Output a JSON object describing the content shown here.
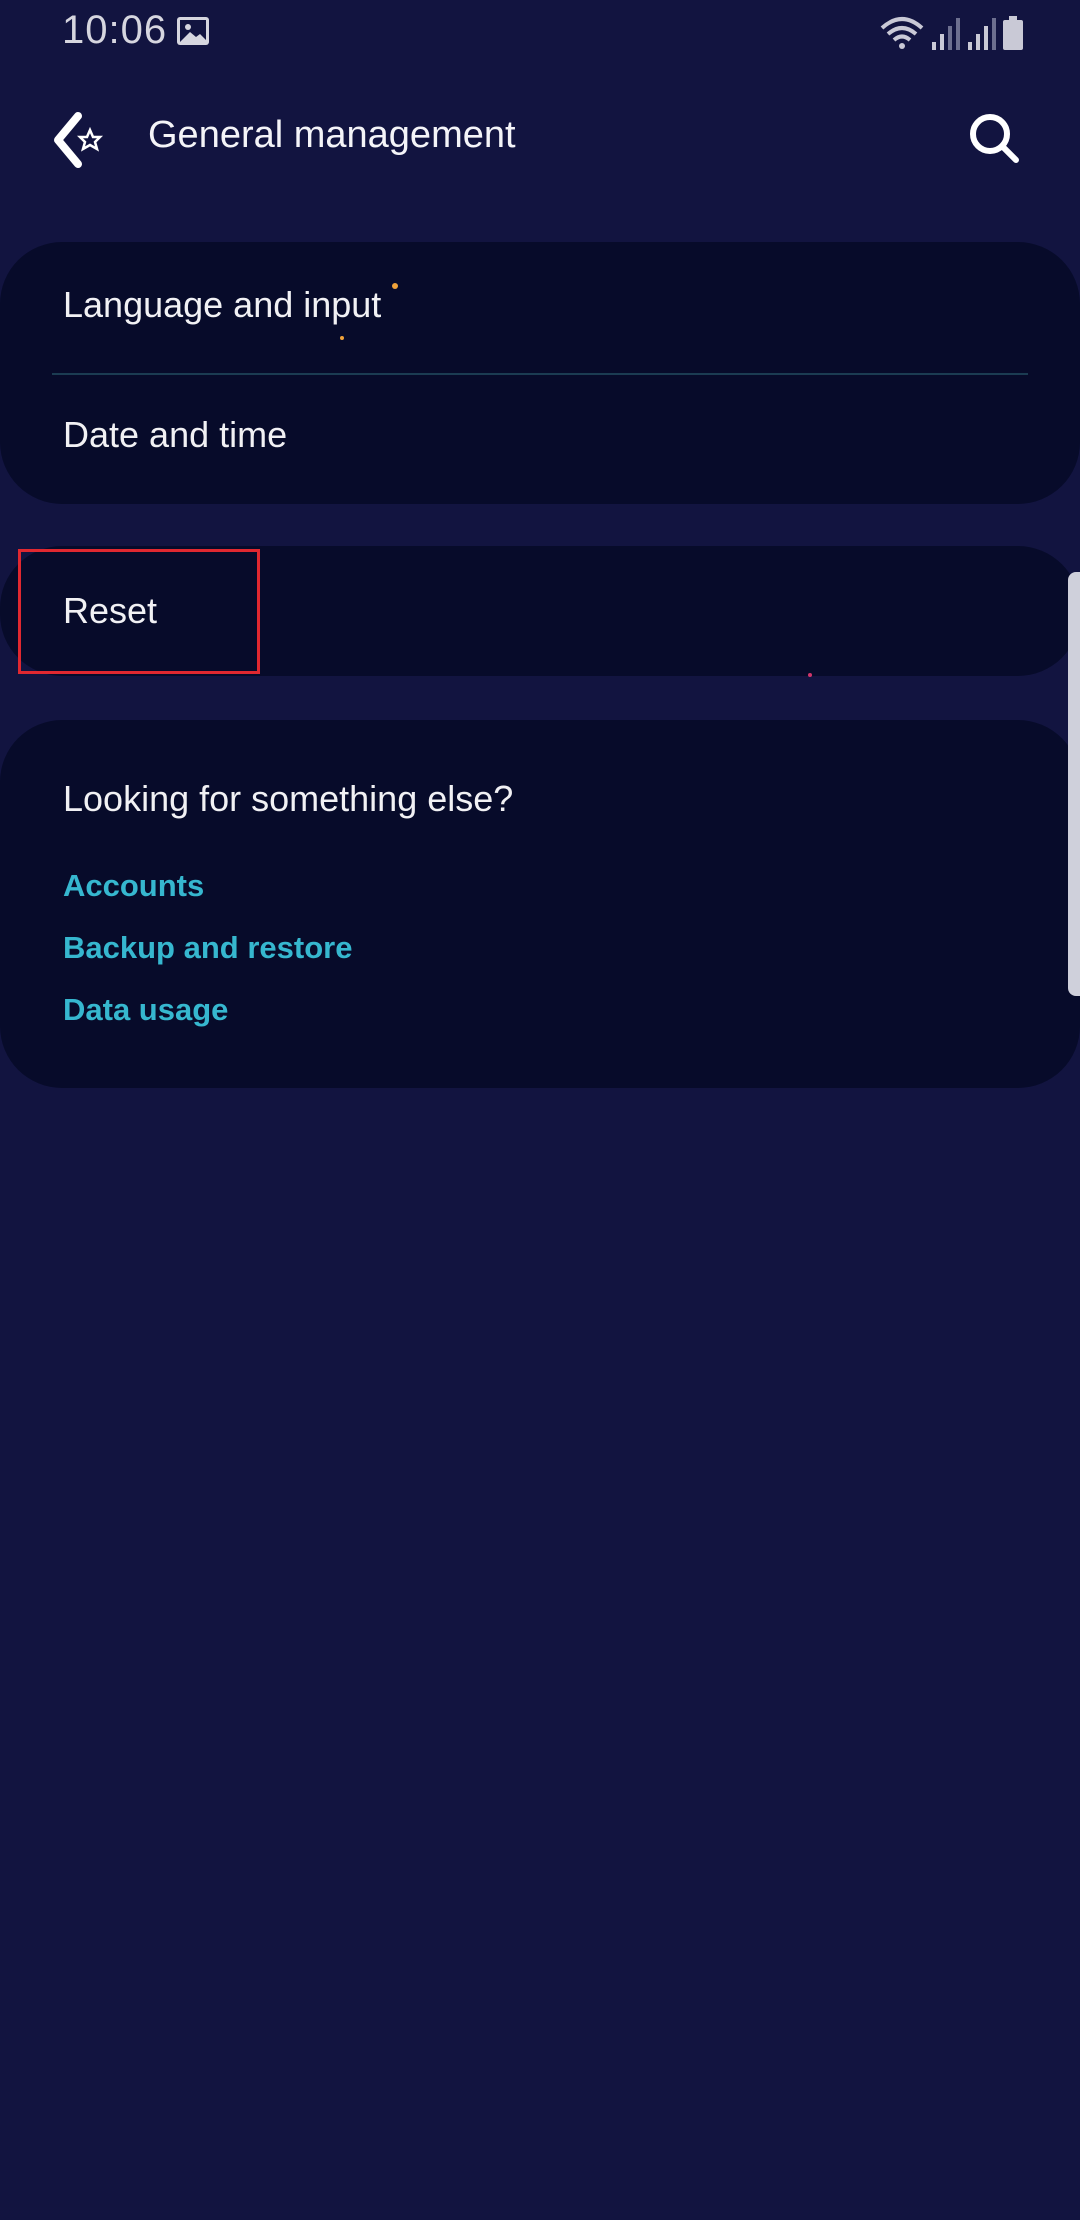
{
  "status_bar": {
    "time": "10:06",
    "icons": [
      "gallery-icon",
      "wifi-icon",
      "signal-icon",
      "signal-icon",
      "battery-icon"
    ]
  },
  "app_bar": {
    "title": "General management",
    "back_icon": "back-icon",
    "search_icon": "search-icon"
  },
  "main_list": {
    "items": [
      {
        "label": "Language and input"
      },
      {
        "label": "Date and time"
      }
    ]
  },
  "reset_section": {
    "label": "Reset"
  },
  "suggestions": {
    "header": "Looking for something else?",
    "links": [
      {
        "label": "Accounts"
      },
      {
        "label": "Backup and restore"
      },
      {
        "label": "Data usage"
      }
    ]
  },
  "colors": {
    "background": "#121440",
    "card": "#070b2a",
    "link": "#36b7cf",
    "highlight": "#e02830",
    "divider": "#1b3c52"
  }
}
